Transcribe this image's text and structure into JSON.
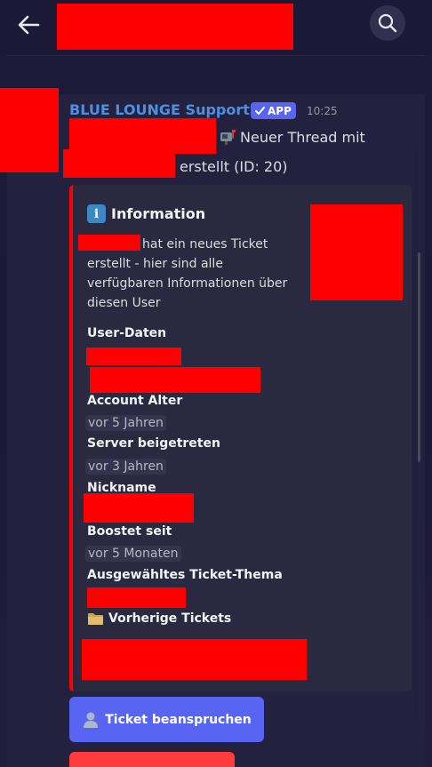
{
  "header": {
    "back_icon": "arrow-left-icon",
    "search_icon": "search-icon"
  },
  "message": {
    "author": "BLUE LOUNGE Support",
    "app_badge": "APP",
    "timestamp": "10:25",
    "line1_text": "Neuer Thread mit",
    "line2_text": "erstellt (ID: 20)"
  },
  "embed": {
    "title": "Information",
    "description": {
      "line1": "hat ein neues Ticket",
      "line2": "erstellt - hier sind alle",
      "line3": "verfügbaren Informationen über",
      "line4": "diesen User"
    },
    "fields": [
      {
        "name": "User-Daten"
      },
      {
        "name": "Account Alter",
        "value": "vor 5 Jahren"
      },
      {
        "name": "Server beigetreten",
        "value": "vor 3 Jahren"
      },
      {
        "name": "Nickname"
      },
      {
        "name": "Boostet seit",
        "value": "vor 5 Monaten"
      },
      {
        "name": "Ausgewähltes Ticket-Thema"
      }
    ],
    "previous_tickets_title": "Vorherige Tickets",
    "accent_color": "#ff0000"
  },
  "buttons": {
    "claim_label": "Ticket beanspruchen"
  },
  "colors": {
    "blurple": "#5865f2",
    "author_blue": "#4f8fe0",
    "background": "#1b1936"
  }
}
